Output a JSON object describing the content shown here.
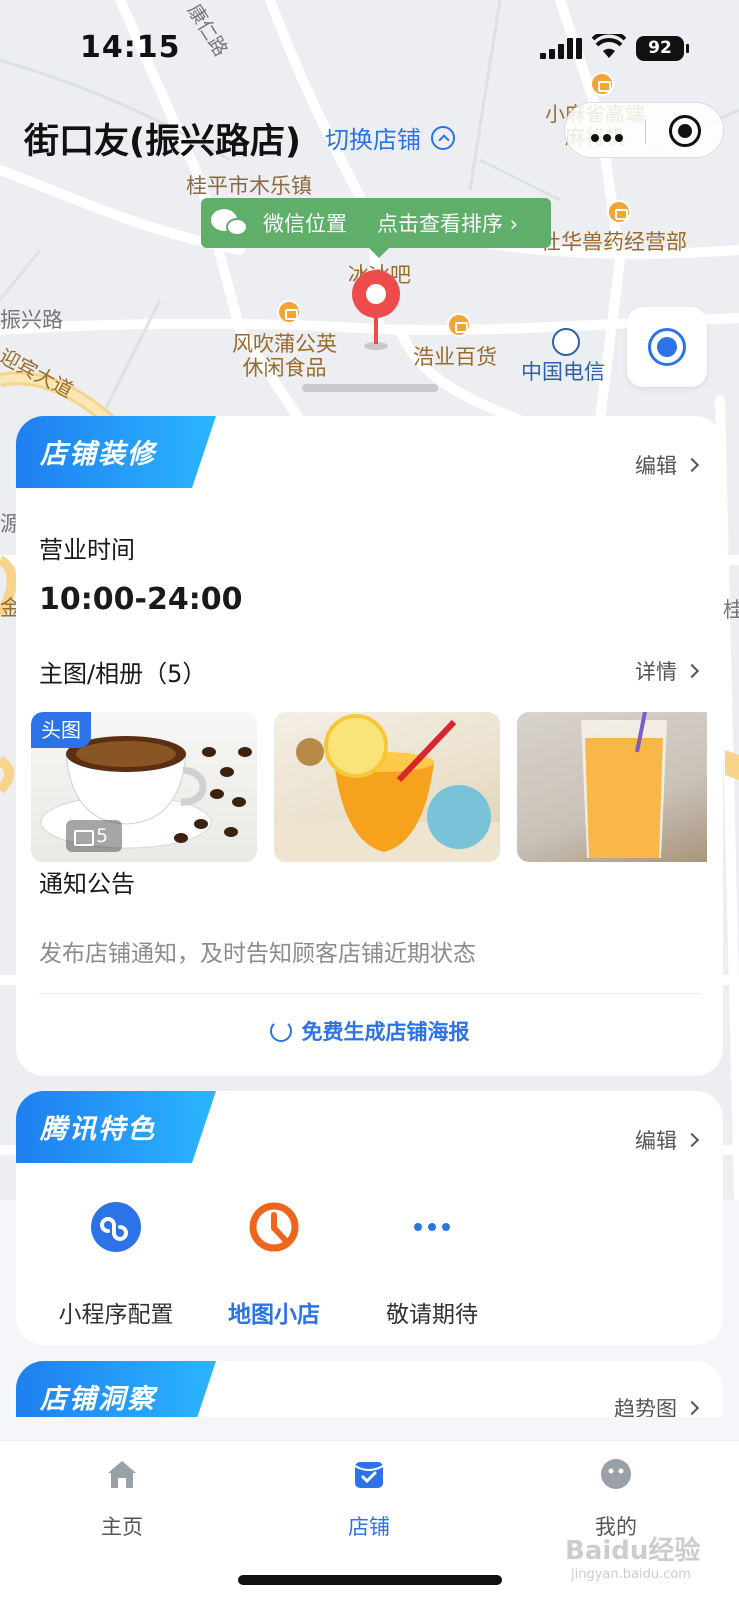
{
  "status_bar": {
    "time": "14:15",
    "battery": "92"
  },
  "header": {
    "store_name": "街口友(振兴路店)",
    "switch_store": "切换店铺"
  },
  "map": {
    "wechat_bubble": {
      "label": "微信位置",
      "action": "点击查看排序 ›"
    },
    "labels": {
      "road_kang": "康仁路",
      "town": "桂平市木乐镇",
      "pet": "杜华兽药经营部",
      "mahjong": "小麻雀高端\n麻将机",
      "binbin": "冰冰吧",
      "zhenxing": "振兴路",
      "yingbin": "迎宾大道",
      "fengchui": "风吹蒲公英\n休闲食品",
      "haoye": "浩业百货",
      "telecom": "中国电信",
      "left1": "源",
      "left2": "金",
      "right1": "桂"
    }
  },
  "store_card": {
    "tag": "店铺装修",
    "edit": "编辑",
    "hours_title": "营业时间",
    "hours_value": "10:00-24:00",
    "album_title": "主图/相册（5）",
    "album_detail": "详情",
    "cover_tag": "头图",
    "photo_count": "5",
    "notice_title": "通知公告",
    "notice_desc": "发布店铺通知，及时告知顾客店铺近期状态",
    "poster_button": "免费生成店铺海报"
  },
  "tencent_card": {
    "tag": "腾讯特色",
    "edit": "编辑",
    "features": [
      {
        "label": "小程序配置",
        "icon": "mini-program-icon"
      },
      {
        "label": "地图小店",
        "icon": "map-shop-icon",
        "active": true
      },
      {
        "label": "敬请期待",
        "icon": "more-dots-icon"
      }
    ]
  },
  "insight_card": {
    "tag": "店铺洞察",
    "trend": "趋势图"
  },
  "tabbar": {
    "items": [
      {
        "label": "主页",
        "icon": "home-icon"
      },
      {
        "label": "店铺",
        "icon": "store-icon",
        "active": true
      },
      {
        "label": "我的",
        "icon": "profile-icon"
      }
    ]
  },
  "watermark": {
    "main": "Baidu经验",
    "sub": "jingyan.baidu.com"
  },
  "colors": {
    "accent": "#2b73e6",
    "wechat_green": "#5fae6a",
    "pin_red": "#f04b4b",
    "poi_orange": "#f3a533"
  }
}
